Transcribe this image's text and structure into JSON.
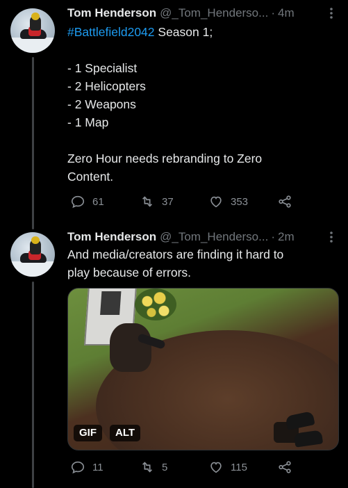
{
  "tweets": [
    {
      "name": "Tom Henderson",
      "handle": "@_Tom_Henderso...",
      "separator": "·",
      "time": "4m",
      "hashtag": "#Battlefield2042",
      "line1_rest": " Season 1;",
      "lines": [
        "- 1 Specialist",
        "- 2 Helicopters",
        "- 2 Weapons",
        "- 1 Map"
      ],
      "closing": [
        "Zero Hour needs rebranding to Zero",
        "Content."
      ],
      "replies": "61",
      "retweets": "37",
      "likes": "353",
      "icons": {
        "reply": "reply-icon",
        "retweet": "retweet-icon",
        "like": "heart-icon",
        "share": "share-icon",
        "more": "more-icon"
      }
    },
    {
      "name": "Tom Henderson",
      "handle": "@_Tom_Henderso...",
      "separator": "·",
      "time": "2m",
      "lines": [
        "And media/creators are finding it hard to",
        "play because of errors."
      ],
      "media_badges": {
        "gif": "GIF",
        "alt": "ALT"
      },
      "replies": "11",
      "retweets": "5",
      "likes": "115"
    }
  ],
  "colors": {
    "background": "#000000",
    "text": "#e7e9ea",
    "muted": "#71767b",
    "link": "#1d9bf0"
  }
}
